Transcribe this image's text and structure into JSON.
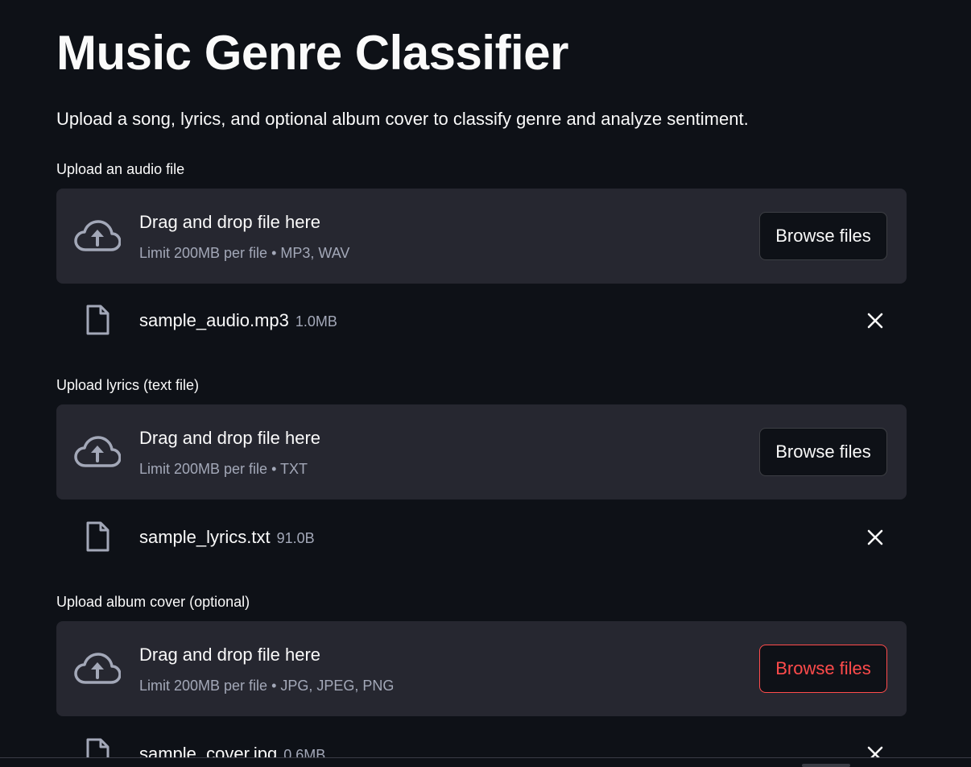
{
  "app": {
    "title": "Music Genre Classifier",
    "subtitle": "Upload a song, lyrics, and optional album cover to classify genre and analyze sentiment."
  },
  "uploaders": [
    {
      "label": "Upload an audio file",
      "drop_text": "Drag and drop file here",
      "limit_text": "Limit 200MB per file • MP3, WAV",
      "browse_label": "Browse files",
      "file": {
        "name": "sample_audio.mp3",
        "size": "1.0MB"
      }
    },
    {
      "label": "Upload lyrics (text file)",
      "drop_text": "Drag and drop file here",
      "limit_text": "Limit 200MB per file • TXT",
      "browse_label": "Browse files",
      "file": {
        "name": "sample_lyrics.txt",
        "size": "91.0B"
      }
    },
    {
      "label": "Upload album cover (optional)",
      "drop_text": "Drag and drop file here",
      "limit_text": "Limit 200MB per file • JPG, JPEG, PNG",
      "browse_label": "Browse files",
      "file": {
        "name": "sample_cover.jpg",
        "size": "0.6MB"
      }
    }
  ],
  "icons": {
    "upload": "cloud-upload-icon",
    "file": "file-icon",
    "remove": "close-icon"
  },
  "colors": {
    "background": "#0e1117",
    "dropzone": "#262730",
    "accent": "#ff4b4b",
    "muted_text": "#a3a8b8"
  }
}
